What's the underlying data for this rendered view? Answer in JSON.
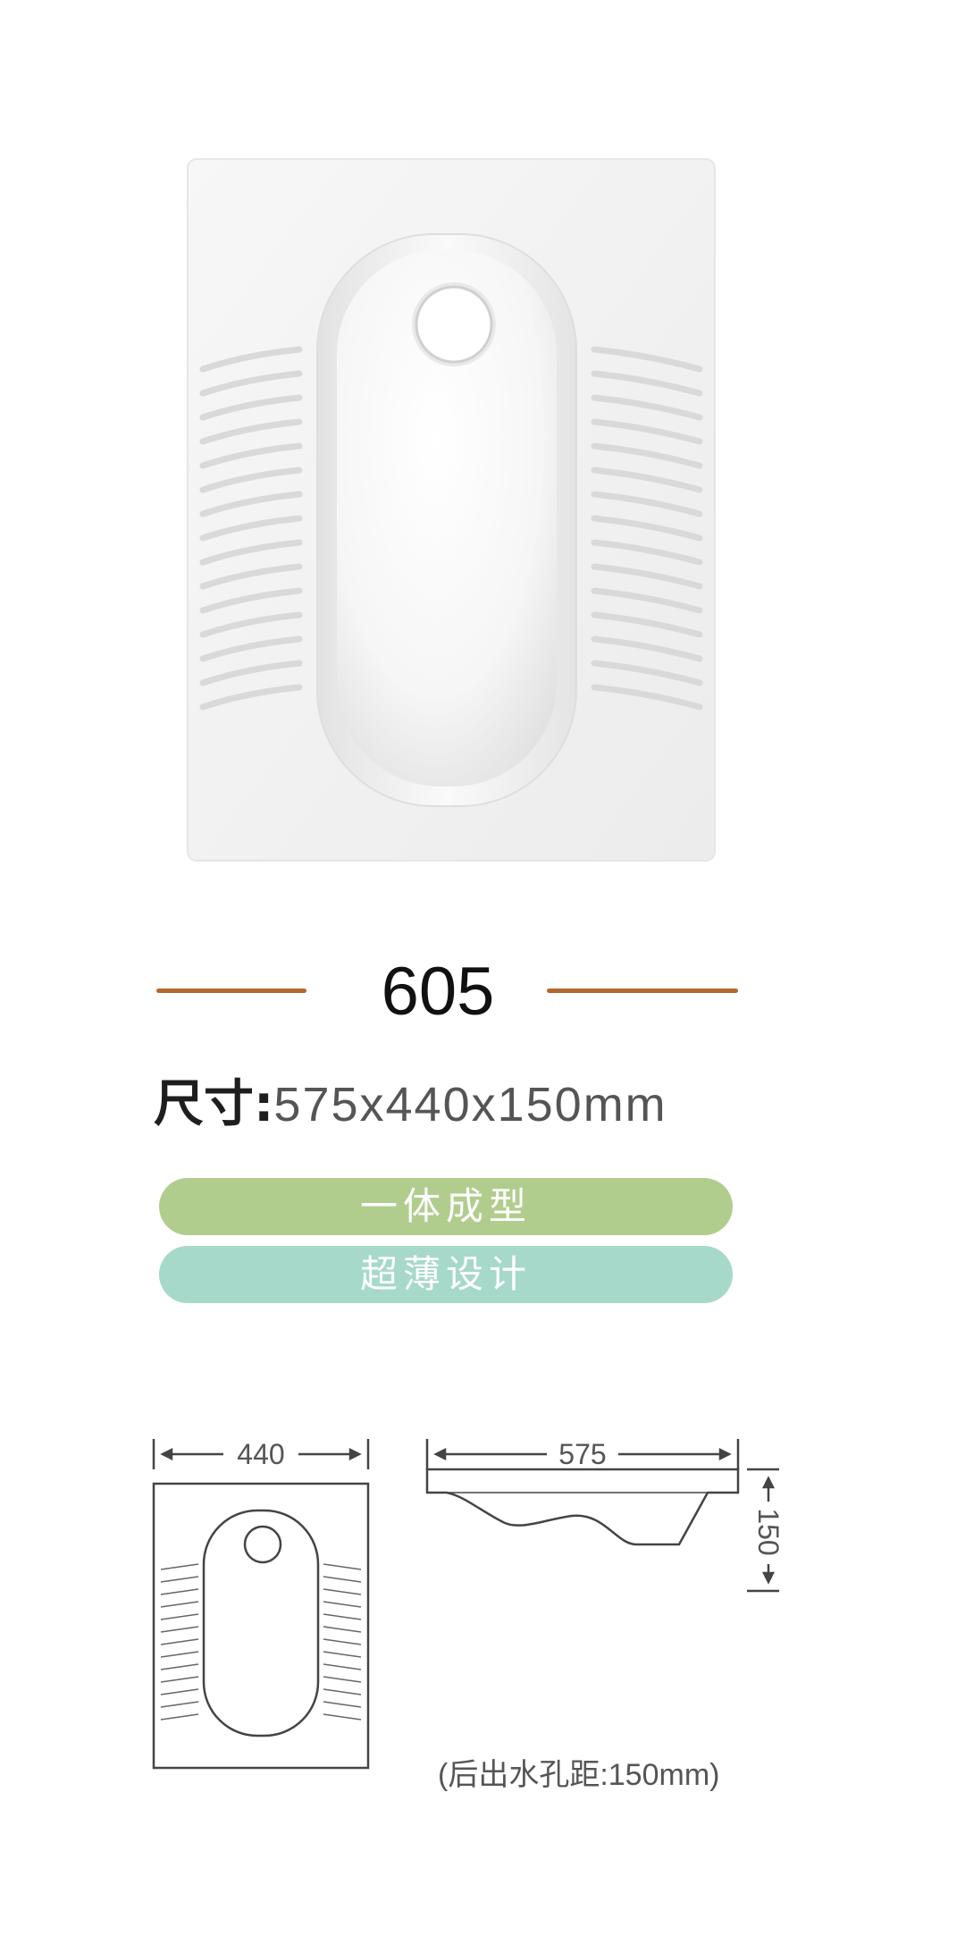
{
  "product": {
    "image_name": "squat-toilet-photo",
    "model": "605",
    "size_label": "尺寸:",
    "size_value": "575x440x150mm",
    "features": [
      "一体成型",
      "超薄设计"
    ],
    "accent_color": "#b5662a",
    "pill_colors": [
      "#b1cd8e",
      "#a6d9c9"
    ]
  },
  "drawing": {
    "top_width": "440",
    "side_length": "575",
    "side_height": "150",
    "note": "(后出水孔距:150mm)"
  }
}
